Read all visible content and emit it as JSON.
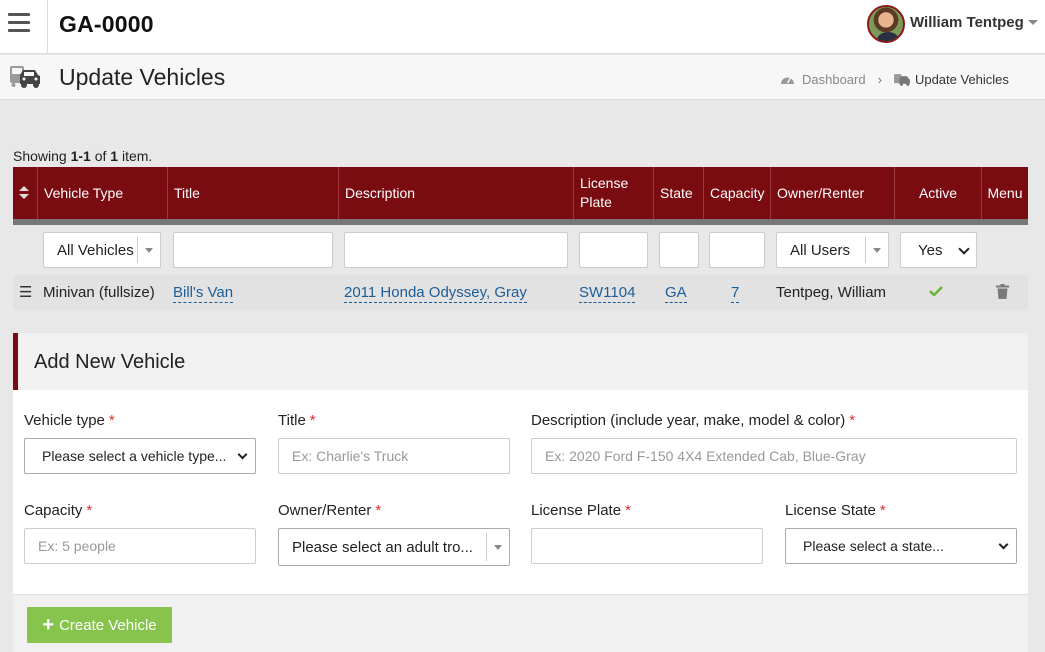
{
  "app": {
    "brand": "GA-0000",
    "user": {
      "name": "William Tentpeg"
    }
  },
  "page": {
    "title": "Update Vehicles",
    "breadcrumb": [
      {
        "label": "Dashboard",
        "icon": "dashboard-icon"
      },
      {
        "label": "Update Vehicles",
        "icon": "vehicles-icon"
      }
    ]
  },
  "grid": {
    "summary": {
      "prefix": "Showing ",
      "range": "1-1",
      "of": " of ",
      "total": "1",
      "suffix": " item."
    },
    "columns": [
      "Vehicle Type",
      "Title",
      "Description",
      "License Plate",
      "State",
      "Capacity",
      "Owner/Renter",
      "Active",
      "Menu"
    ],
    "filters": {
      "vehicle_type": "All Vehicles",
      "owner": "All Users",
      "active": "Yes"
    },
    "rows": [
      {
        "vehicle_type": "Minivan (fullsize)",
        "title": "Bill's Van",
        "description": "2011 Honda Odyssey, Gray",
        "license_plate": "SW1104",
        "state": "GA",
        "capacity": "7",
        "owner": "Tentpeg, William",
        "active": true
      }
    ]
  },
  "form": {
    "title": "Add New Vehicle",
    "required_mark": "*",
    "vehicle_type": {
      "label": "Vehicle type",
      "value": "Please select a vehicle type..."
    },
    "title_field": {
      "label": "Title",
      "placeholder": "Ex: Charlie's Truck"
    },
    "description": {
      "label": "Description (include year, make, model & color)",
      "placeholder": "Ex: 2020 Ford F-150 4X4 Extended Cab, Blue-Gray"
    },
    "capacity": {
      "label": "Capacity",
      "placeholder": "Ex: 5 people"
    },
    "owner": {
      "label": "Owner/Renter",
      "value": "Please select an adult tro..."
    },
    "license_plate": {
      "label": "License Plate",
      "placeholder": ""
    },
    "license_state": {
      "label": "License State",
      "value": "Please select a state..."
    },
    "submit": {
      "label": "Create Vehicle"
    }
  },
  "colors": {
    "header_bg": "#7a0b10",
    "link": "#1d5d96",
    "button_bg": "#86c44e",
    "check": "#6bb33a",
    "required": "#d9302c"
  }
}
